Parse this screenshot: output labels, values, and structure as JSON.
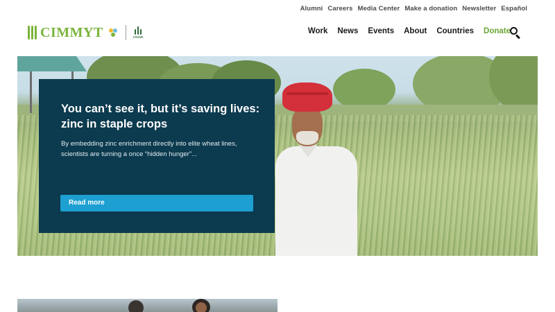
{
  "utility_nav": [
    "Alumni",
    "Careers",
    "Media Center",
    "Make a donation",
    "Newsletter",
    "Español"
  ],
  "logo": {
    "text": "CIMMYT",
    "partner": "CGIAR"
  },
  "main_nav": [
    "Work",
    "News",
    "Events",
    "About",
    "Countries",
    "Donate"
  ],
  "colors": {
    "brand_green": "#79b43a",
    "card_bg": "#0c3a4e",
    "cta_blue": "#1d9fd2",
    "donate_green": "#6aa534"
  },
  "hero": {
    "title": "You can’t see it, but it’s saving lives: zinc in staple crops",
    "summary": "By embedding zinc enrichment directly into elite wheat lines, scientists are turning a once “hidden hunger”...",
    "cta_label": "Read more"
  },
  "icons": {
    "search": "search-icon"
  }
}
